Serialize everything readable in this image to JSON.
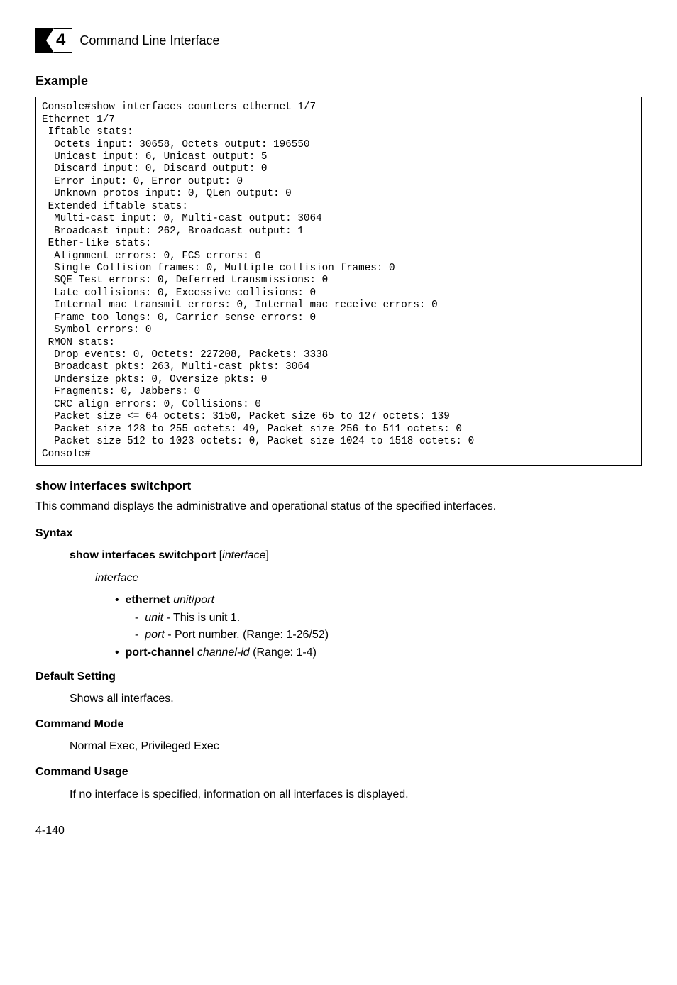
{
  "header": {
    "chapter_number": "4",
    "chapter_title": "Command Line Interface"
  },
  "example": {
    "heading": "Example",
    "code": "Console#show interfaces counters ethernet 1/7\nEthernet 1/7\n Iftable stats:\n  Octets input: 30658, Octets output: 196550\n  Unicast input: 6, Unicast output: 5\n  Discard input: 0, Discard output: 0\n  Error input: 0, Error output: 0\n  Unknown protos input: 0, QLen output: 0\n Extended iftable stats:\n  Multi-cast input: 0, Multi-cast output: 3064\n  Broadcast input: 262, Broadcast output: 1\n Ether-like stats:\n  Alignment errors: 0, FCS errors: 0\n  Single Collision frames: 0, Multiple collision frames: 0\n  SQE Test errors: 0, Deferred transmissions: 0\n  Late collisions: 0, Excessive collisions: 0\n  Internal mac transmit errors: 0, Internal mac receive errors: 0\n  Frame too longs: 0, Carrier sense errors: 0\n  Symbol errors: 0\n RMON stats:\n  Drop events: 0, Octets: 227208, Packets: 3338\n  Broadcast pkts: 263, Multi-cast pkts: 3064\n  Undersize pkts: 0, Oversize pkts: 0\n  Fragments: 0, Jabbers: 0\n  CRC align errors: 0, Collisions: 0\n  Packet size <= 64 octets: 3150, Packet size 65 to 127 octets: 139\n  Packet size 128 to 255 octets: 49, Packet size 256 to 511 octets: 0\n  Packet size 512 to 1023 octets: 0, Packet size 1024 to 1518 octets: 0\nConsole#"
  },
  "command": {
    "name": "show interfaces switchport",
    "description": "This command displays the administrative and operational status of the specified interfaces."
  },
  "syntax": {
    "heading": "Syntax",
    "cmd_bold": "show interfaces switchport",
    "cmd_bracket_open": " [",
    "cmd_arg": "interface",
    "cmd_bracket_close": "]",
    "arg_name": "interface",
    "bullet1_label": "ethernet",
    "bullet1_arg": "unit",
    "bullet1_slash": "/",
    "bullet1_arg2": "port",
    "sub1_arg": "unit",
    "sub1_text": " - This is unit 1.",
    "sub2_arg": "port",
    "sub2_text": " - Port number. (Range: 1-26/52)",
    "bullet2_label": "port-channel",
    "bullet2_arg": "channel-id",
    "bullet2_text": " (Range: 1-4)"
  },
  "default": {
    "heading": "Default Setting",
    "text": "Shows all interfaces."
  },
  "mode": {
    "heading": "Command Mode",
    "text": "Normal Exec, Privileged Exec"
  },
  "usage": {
    "heading": "Command Usage",
    "text": "If no interface is specified, information on all interfaces is displayed."
  },
  "footer": {
    "page": "4-140"
  }
}
